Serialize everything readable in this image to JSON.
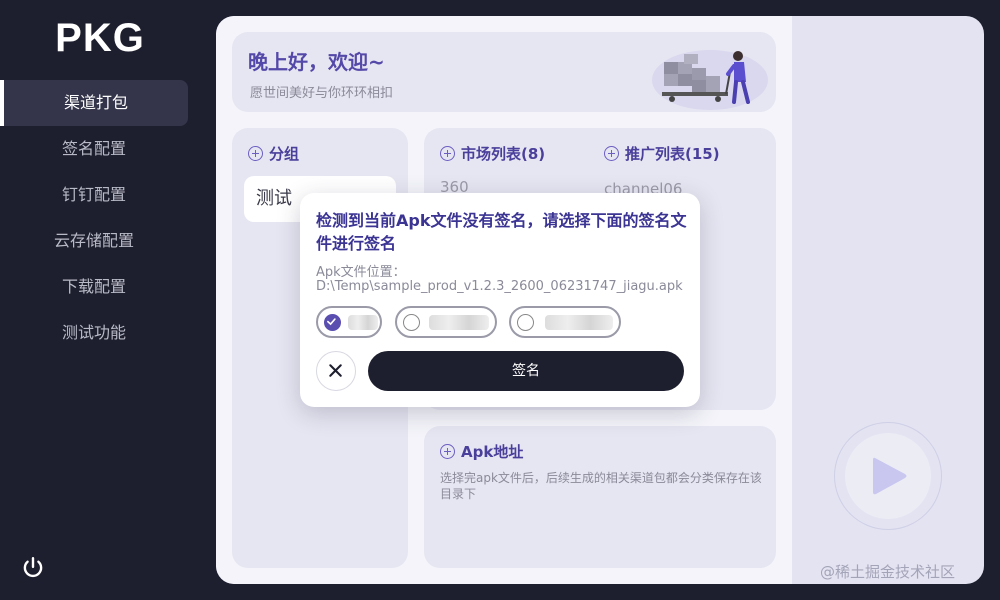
{
  "app": {
    "logo": "PKG"
  },
  "sidebar": {
    "items": [
      {
        "label": "渠道打包",
        "active": true
      },
      {
        "label": "签名配置"
      },
      {
        "label": "钉钉配置"
      },
      {
        "label": "云存储配置"
      },
      {
        "label": "下载配置"
      },
      {
        "label": "测试功能"
      }
    ],
    "power_icon": "power-icon"
  },
  "greeting": {
    "title": "晚上好，欢迎~",
    "subtitle": "愿世间美好与你环环相扣"
  },
  "groups": {
    "title": "分组",
    "items": [
      "测试"
    ]
  },
  "markets": {
    "title": "市场列表(8)",
    "items": [
      "360"
    ]
  },
  "promotions": {
    "title": "推广列表(15)",
    "items": [
      "channel06"
    ]
  },
  "apk": {
    "title": "Apk地址",
    "description": "选择完apk文件后，后续生成的相关渠道包都会分类保存在该目录下"
  },
  "dialog": {
    "title": "检测到当前Apk文件没有签名，请选择下面的签名文件进行签名",
    "location_label": "Apk文件位置：",
    "path": "D:\\Temp\\sample_prod_v1.2.3_2600_06231747_jiagu.apk",
    "sign_label": "签名",
    "close_icon": "close-icon"
  },
  "watermark": "@稀土掘金技术社区",
  "colors": {
    "sidebar_bg": "#1e1f2e",
    "accent": "#5a4fb0",
    "card_bg": "#e6e6f2"
  }
}
